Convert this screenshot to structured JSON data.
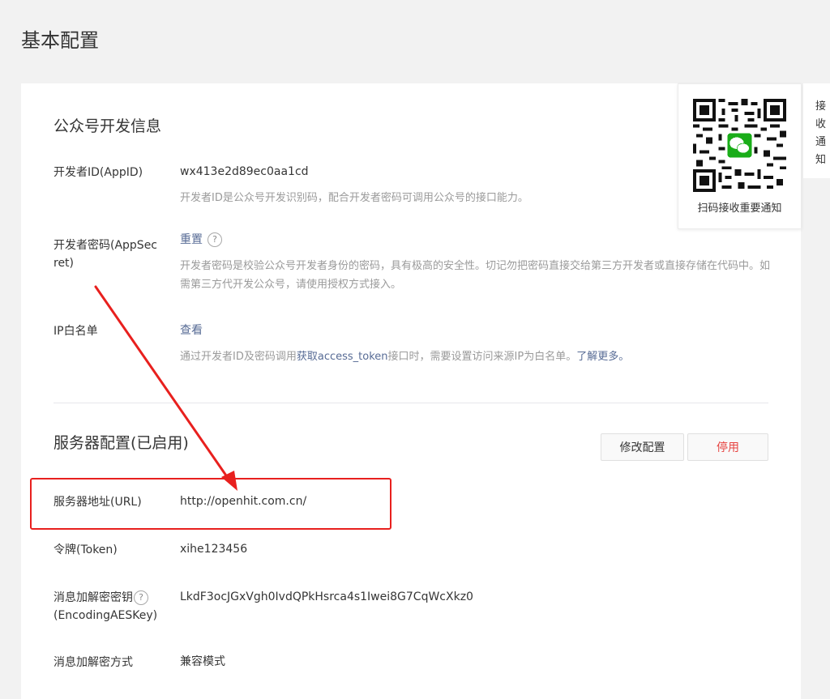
{
  "page": {
    "title": "基本配置"
  },
  "dev_info": {
    "title": "公众号开发信息",
    "appid": {
      "label": "开发者ID(AppID)",
      "value": "wx413e2d89ec0aa1cd",
      "desc": "开发者ID是公众号开发识别码，配合开发者密码可调用公众号的接口能力。"
    },
    "appsecret": {
      "label": "开发者密码(AppSecret)",
      "link": "重置",
      "help": "?",
      "desc": "开发者密码是校验公众号开发者身份的密码，具有极高的安全性。切记勿把密码直接交给第三方开发者或直接存储在代码中。如需第三方代开发公众号，请使用授权方式接入。"
    },
    "ip_whitelist": {
      "label": "IP白名单",
      "link": "查看",
      "desc_prefix": "通过开发者ID及密码调用",
      "desc_link": "获取access_token",
      "desc_middle": "接口时，需要设置访问来源IP为白名单。",
      "desc_more": "了解更多。"
    }
  },
  "server_config": {
    "title": "服务器配置(已启用)",
    "edit_button": "修改配置",
    "disable_button": "停用",
    "url": {
      "label": "服务器地址(URL)",
      "value": "http://openhit.com.cn/"
    },
    "token": {
      "label": "令牌(Token)",
      "value": "xihe123456"
    },
    "aeskey": {
      "label": "消息加解密密钥",
      "label_sub": "(EncodingAESKey)",
      "help": "?",
      "value": "LkdF3ocJGxVgh0IvdQPkHsrca4s1Iwei8G7CqWcXkz0"
    },
    "encrypt_mode": {
      "label": "消息加解密方式",
      "value": "兼容模式"
    }
  },
  "qr_card": {
    "caption": "扫码接收重要通知"
  },
  "side_tab": {
    "text": "接收通知"
  },
  "colors": {
    "link": "#576b95",
    "danger": "#e64340",
    "annotation": "#e8201e",
    "wechat_green": "#1aad19"
  }
}
